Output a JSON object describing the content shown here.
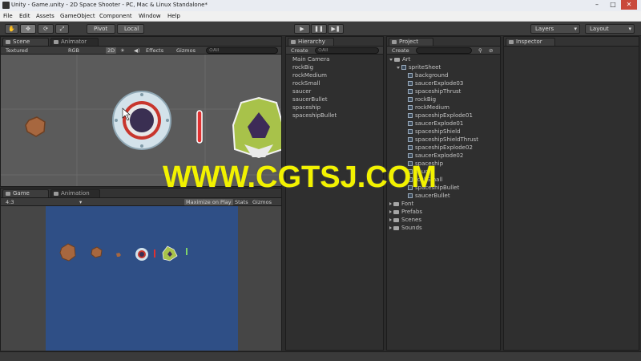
{
  "window": {
    "title": "Unity - Game.unity - 2D Space Shooter - PC, Mac & Linux Standalone*",
    "controls": [
      "–",
      "□",
      "✕"
    ]
  },
  "menu": [
    "File",
    "Edit",
    "Assets",
    "GameObject",
    "Component",
    "Window",
    "Help"
  ],
  "toolbar": {
    "tools": [
      "hand-icon",
      "move-icon",
      "rotate-icon",
      "scale-icon"
    ],
    "pivot": "Pivot",
    "local": "Local",
    "play": "▶",
    "pause": "❚❚",
    "step": "▶❚",
    "layers": "Layers",
    "layout": "Layout"
  },
  "scene": {
    "tab": "Scene",
    "tab2": "Animator",
    "shading": "Textured",
    "render": "RGB",
    "mode2d": "2D",
    "effects": "Effects",
    "gizmos": "Gizmos",
    "search": "⊙All"
  },
  "game": {
    "tab": "Game",
    "tab2": "Animation",
    "aspect": "4:3",
    "maximize": "Maximize on Play",
    "stats": "Stats",
    "gizmos": "Gizmos",
    "background": "#2f4f86"
  },
  "hierarchy": {
    "tab": "Hierarchy",
    "create": "Create",
    "search": "⊙All",
    "items": [
      "Main Camera",
      "rockBig",
      "rockMedium",
      "rockSmall",
      "saucer",
      "saucerBullet",
      "spaceship",
      "spaceshipBullet"
    ]
  },
  "project": {
    "tab": "Project",
    "create": "Create",
    "root": "Art",
    "sheet": "spriteSheet",
    "sprites": [
      "background",
      "saucerExplode03",
      "spaceshipThrust",
      "rockBig",
      "rockMedium",
      "spaceshipExplode01",
      "saucerExplode01",
      "spaceshipShield",
      "spaceshipShieldThrust",
      "spaceshipExplode02",
      "saucerExplode02",
      "spaceship",
      "saucer",
      "rockSmall",
      "spaceshipBullet",
      "saucerBullet"
    ],
    "folders": [
      "Font",
      "Prefabs",
      "Scenes",
      "Sounds"
    ]
  },
  "inspector": {
    "tab": "Inspector"
  },
  "watermark": "WWW.CGTSJ.COM"
}
